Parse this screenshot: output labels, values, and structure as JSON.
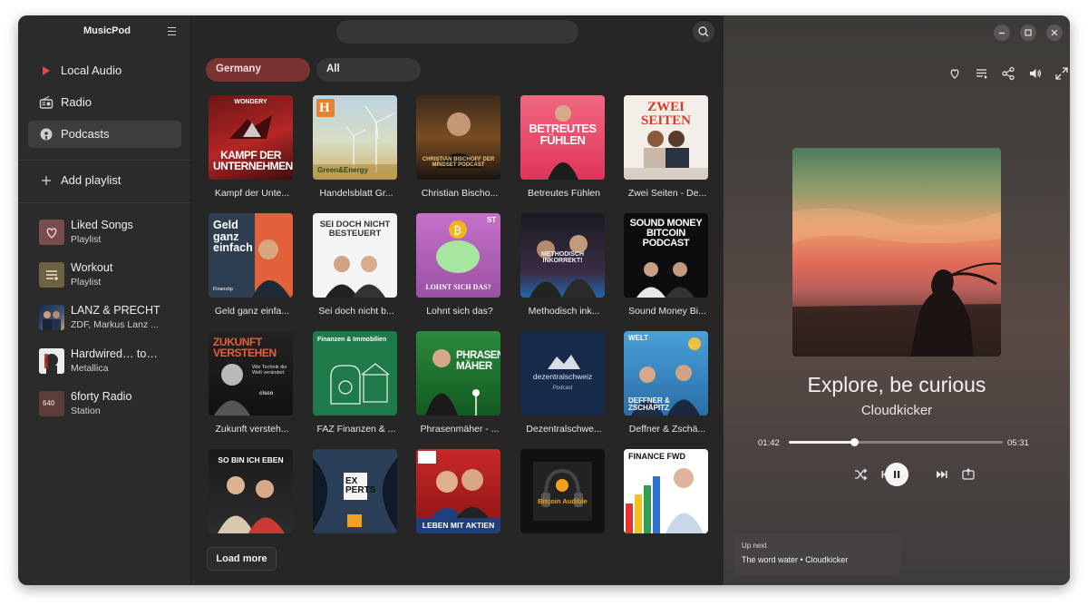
{
  "app": {
    "title": "MusicPod"
  },
  "nav": [
    {
      "label": "Local Audio",
      "icon": "play-icon"
    },
    {
      "label": "Radio",
      "icon": "radio-icon"
    },
    {
      "label": "Podcasts",
      "icon": "podcast-icon",
      "active": true
    }
  ],
  "add_playlist": {
    "label": "Add playlist"
  },
  "library": [
    {
      "title": "Liked Songs",
      "subtitle": "Playlist",
      "icon": "heart-icon"
    },
    {
      "title": "Workout",
      "subtitle": "Playlist",
      "icon": "playlist-icon"
    },
    {
      "title": "LANZ & PRECHT",
      "subtitle": "ZDF, Markus Lanz ...",
      "icon": "podcast-cover"
    },
    {
      "title": "Hardwired… to…",
      "subtitle": "Metallica",
      "icon": "album-cover"
    },
    {
      "title": "6forty Radio",
      "subtitle": "Station",
      "icon": "radio-station-icon",
      "badge": "640"
    }
  ],
  "search": {
    "placeholder": ""
  },
  "filters": {
    "country": "Germany",
    "category": "All"
  },
  "podcasts": [
    {
      "title": "Kampf der Unte...",
      "cover_text": "KAMPF DER UNTERNEHMEN",
      "brand": "WONDERY"
    },
    {
      "title": "Handelsblatt Gr...",
      "cover_text": "Green&Energy",
      "brand": "H"
    },
    {
      "title": "Christian Bischo...",
      "cover_text": "CHRISTIAN BISCHOFF DER MINDSET PODCAST"
    },
    {
      "title": "Betreutes Fühlen",
      "cover_text": "BETREUTES FÜHLEN"
    },
    {
      "title": "Zwei Seiten - De...",
      "cover_text": "ZWEI SEITEN"
    },
    {
      "title": "Geld ganz einfa...",
      "cover_text": "Geld ganz einfach",
      "brand": "Finanztip"
    },
    {
      "title": "Sei doch nicht b...",
      "cover_text": "SEI DOCH NICHT BESTEUERT"
    },
    {
      "title": "Lohnt sich das?",
      "cover_text": "LOHNT SICH DAS?",
      "brand": "ST"
    },
    {
      "title": "Methodisch ink...",
      "cover_text": "METHODISCH INKORREKT!"
    },
    {
      "title": "Sound Money Bi...",
      "cover_text": "SOUND MONEY BITCOIN PODCAST"
    },
    {
      "title": "Zukunft versteh...",
      "cover_text": "ZUKUNFT VERSTEHEN",
      "sub_text": "Wie Technik die Welt verändert",
      "brand": "cisco"
    },
    {
      "title": "FAZ Finanzen & ...",
      "cover_text": "Finanzen & Immobilien"
    },
    {
      "title": "Phrasenmäher - ...",
      "cover_text": "PHRASEN MÄHER"
    },
    {
      "title": "Dezentralschwe...",
      "cover_text": "dezentralschweiz",
      "sub_text": "Podcast"
    },
    {
      "title": "Deffner & Zschä...",
      "cover_text": "DEFFNER & ZSCHÄPITZ",
      "brand": "WELT"
    },
    {
      "title": "",
      "cover_text": "SO BIN ICH EBEN"
    },
    {
      "title": "",
      "cover_text": "EX PERTS"
    },
    {
      "title": "",
      "cover_text": "LEBEN MIT AKTIEN"
    },
    {
      "title": "",
      "cover_text": "Bitcoin Audible"
    },
    {
      "title": "",
      "cover_text": "FINANCE FWD"
    }
  ],
  "load_more": {
    "label": "Load more"
  },
  "player": {
    "title": "Explore, be curious",
    "artist": "Cloudkicker",
    "position": "01:42",
    "duration": "05:31",
    "progress_fraction": 0.308,
    "up_next_label": "Up next",
    "up_next_track": "The word water • Cloudkicker"
  },
  "colors": {
    "accent": "#7a3232",
    "sidebar": "#2b2b2b",
    "main": "#262626"
  }
}
